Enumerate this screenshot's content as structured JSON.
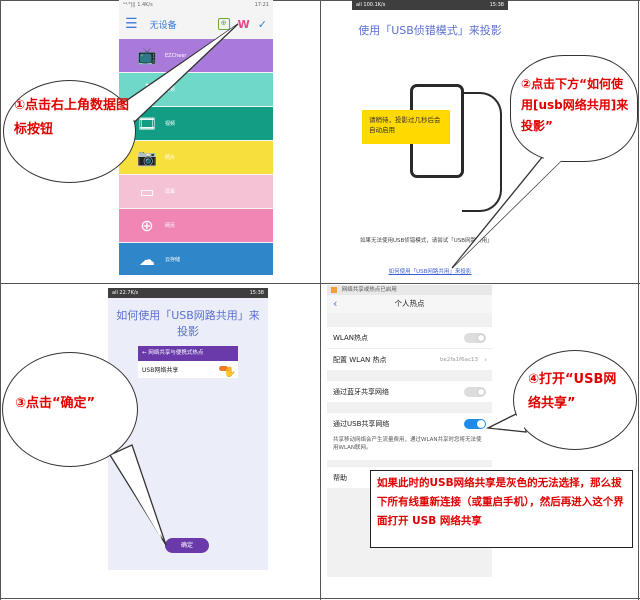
{
  "p1": {
    "title": "无设备",
    "status_left": "ᵃ⁴·⁸||| 1.4K/s",
    "status_right": "17:21",
    "menu": [
      {
        "label": "EZCheer"
      },
      {
        "label": "音频"
      },
      {
        "label": "视频"
      },
      {
        "label": "照片"
      },
      {
        "label": "屏幕"
      },
      {
        "label": "网页"
      },
      {
        "label": "云存储"
      }
    ],
    "callout": "①点击右上角数据图标按钮"
  },
  "p2": {
    "status_left": "all 100.1K/s",
    "status_right": "15:38",
    "title": "使用「USB侦错模式」来投影",
    "banner": "请稍待，投影过几秒后会自动启用",
    "footer": "如果无法使用USB侦错模式，请尝试「USB网路共用」",
    "link": "如何使用「USB网路共用」来投影",
    "callout": "②点击下方“如何使用[usb网络共用]来投影”"
  },
  "p3": {
    "status_left": "all 22.7K/s",
    "status_right": "15:38",
    "title": "如何使用「USB网路共用」来投影",
    "card_header": "← 网络共享与便携式热点",
    "card_item": "USB网络共享",
    "ok": "确定",
    "callout": "③点击“确定”"
  },
  "p4": {
    "notif": "网络共享或热点已启用",
    "title": "个人热点",
    "wlan": "WLAN热点",
    "config": "配置 WLAN 热点",
    "config_value": "be2fa1f6ac13",
    "bt": "通过蓝牙共享网络",
    "usb": "通过USB共享网络",
    "usb_desc": "共享移动网络会产生流量费用，通过WLAN共享时您将无法使用WLAN联网。",
    "help": "帮助",
    "callout": "④打开“USB网络共享”",
    "note": "如果此时的USB网络共享是灰色的无法选择，那么拔下所有线重新连接（或重启手机），然后再进入这个界面打开 USB 网络共享"
  },
  "colors": {
    "purple": "#a97ad9",
    "teal": "#6fd8c8",
    "green": "#119e84",
    "yellow": "#f7e03c",
    "pink": "#f5c1d4",
    "magenta": "#ef86b4",
    "blue": "#2f86c9"
  }
}
